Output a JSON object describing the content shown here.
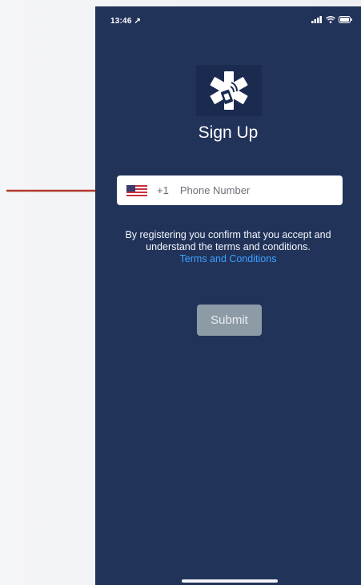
{
  "status_bar": {
    "time": "13:46 ↗",
    "signal_icon": "cellular-signal-icon",
    "wifi_icon": "wifi-icon",
    "battery_icon": "battery-icon"
  },
  "logo": {
    "icon": "medical-star-sim-icon"
  },
  "screen": {
    "title": "Sign Up"
  },
  "phone_field": {
    "flag_icon": "us-flag-icon",
    "country_code": "+1",
    "placeholder": "Phone Number",
    "value": ""
  },
  "consent": {
    "text": "By registering you confirm that you accept and understand the terms and conditions.",
    "link_label": "Terms and Conditions"
  },
  "submit": {
    "label": "Submit",
    "background": "#8c9ba6"
  },
  "colors": {
    "background": "#22335a",
    "annotation_arrow": "#b33a2a",
    "link": "#3ba2ff"
  }
}
